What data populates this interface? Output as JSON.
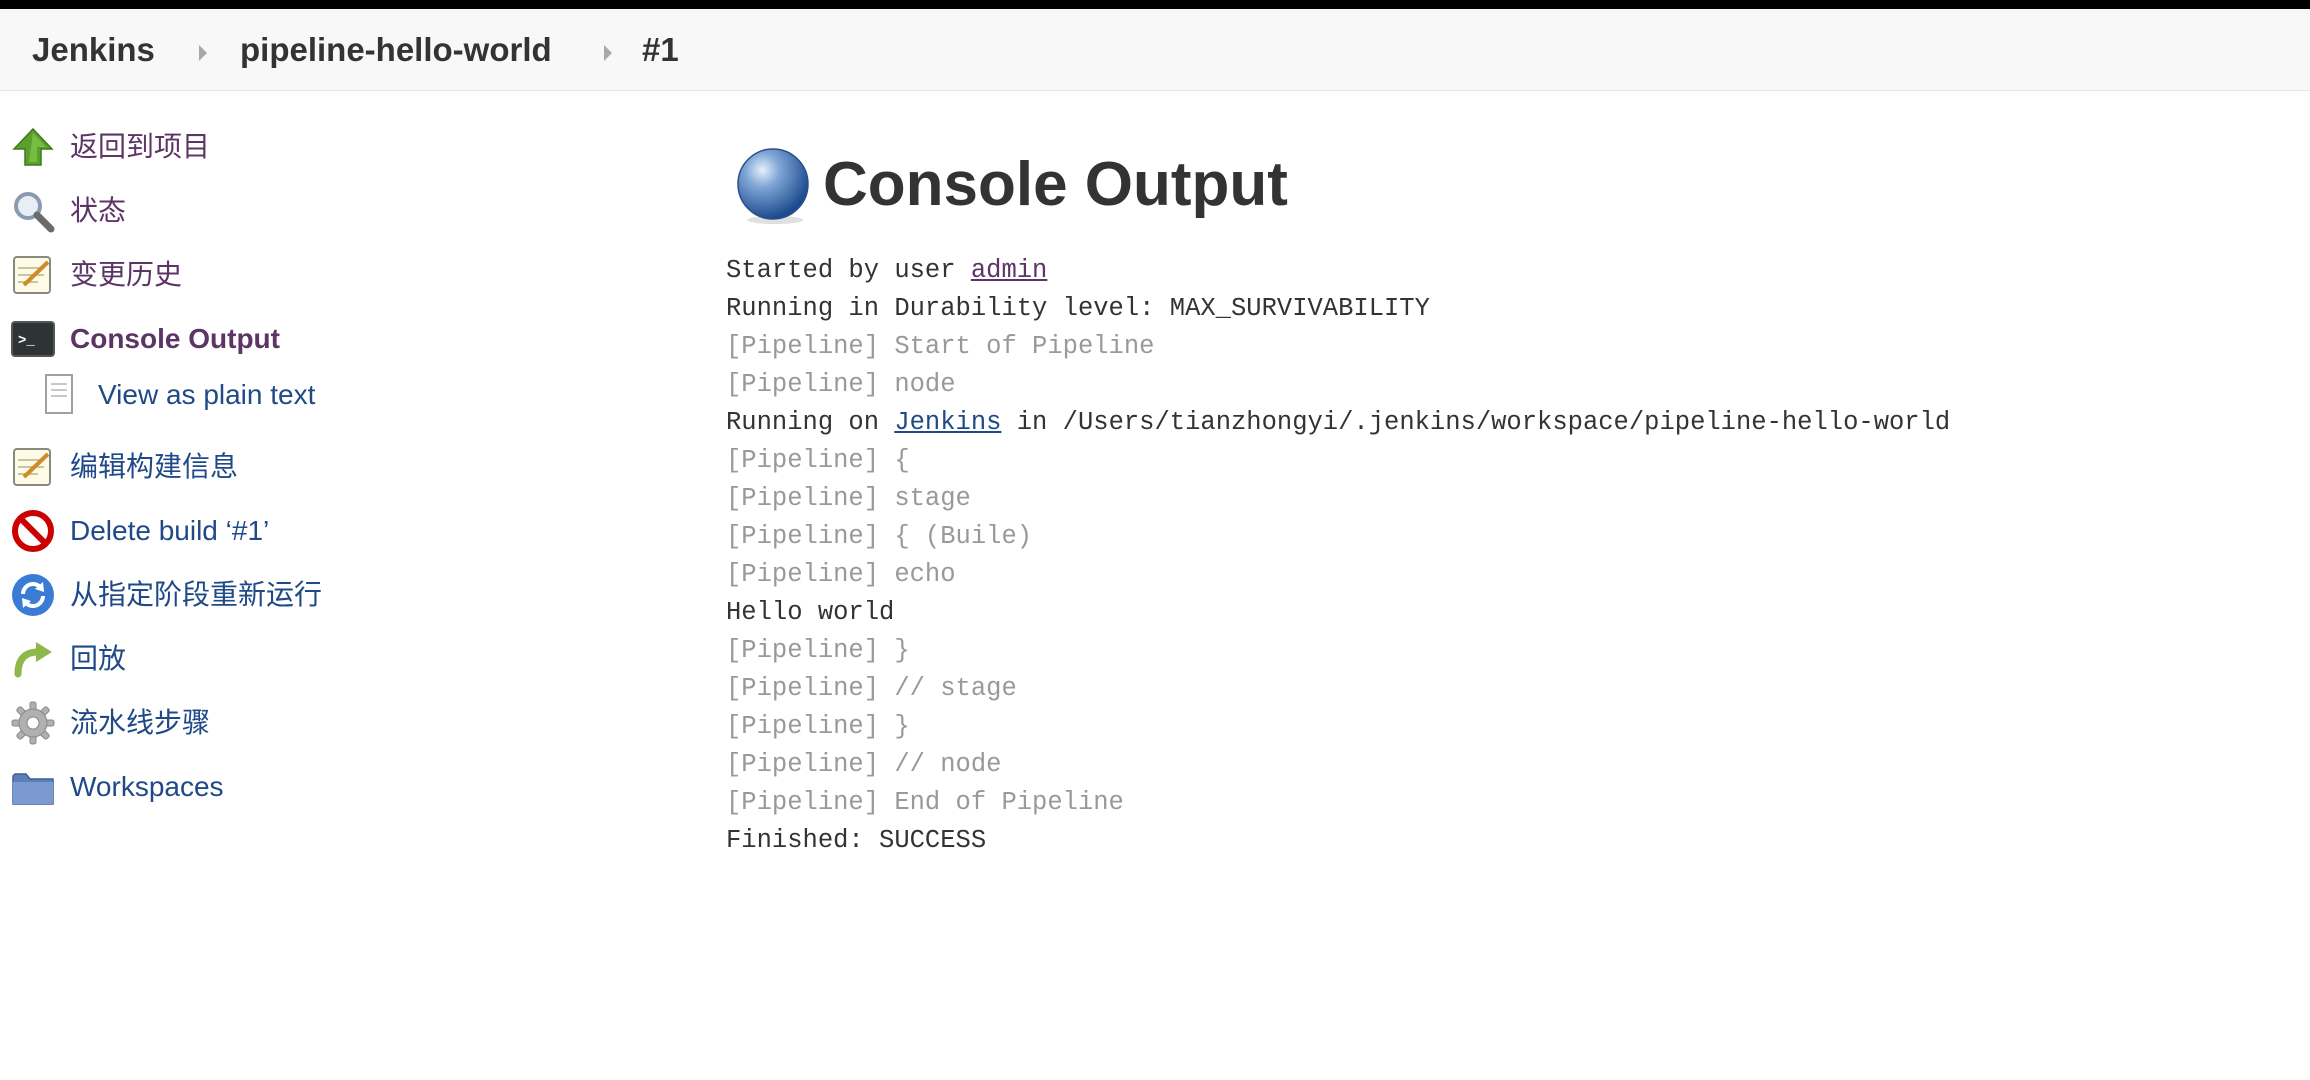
{
  "breadcrumbs": [
    {
      "label": "Jenkins"
    },
    {
      "label": "pipeline-hello-world"
    },
    {
      "label": "#1"
    }
  ],
  "sidebar": {
    "items": [
      {
        "label": "返回到项目",
        "icon": "up-arrow-icon"
      },
      {
        "label": "状态",
        "icon": "search-icon"
      },
      {
        "label": "变更历史",
        "icon": "notepad-icon"
      },
      {
        "label": "Console Output",
        "icon": "terminal-icon",
        "active": true
      },
      {
        "label": "View as plain text",
        "icon": "document-icon"
      },
      {
        "label": "编辑构建信息",
        "icon": "notepad-icon"
      },
      {
        "label": "Delete build ‘#1’",
        "icon": "no-entry-icon"
      },
      {
        "label": "从指定阶段重新运行",
        "icon": "refresh-icon"
      },
      {
        "label": "回放",
        "icon": "redo-arrow-icon"
      },
      {
        "label": "流水线步骤",
        "icon": "gear-icon"
      },
      {
        "label": "Workspaces",
        "icon": "folder-icon"
      }
    ]
  },
  "main": {
    "title": "Console Output",
    "title_icon": "blue-ball-icon",
    "console": {
      "line1_prefix": "Started by user ",
      "line1_link": "admin",
      "line2": "Running in Durability level: MAX_SURVIVABILITY",
      "line3": "[Pipeline] Start of Pipeline",
      "line4": "[Pipeline] node",
      "line5_prefix": "Running on ",
      "line5_link": "Jenkins",
      "line5_suffix": " in /Users/tianzhongyi/.jenkins/workspace/pipeline-hello-world",
      "line6": "[Pipeline] {",
      "line7": "[Pipeline] stage",
      "line8": "[Pipeline] { (Buile)",
      "line9": "[Pipeline] echo",
      "line10": "Hello world",
      "line11": "[Pipeline] }",
      "line12": "[Pipeline] // stage",
      "line13": "[Pipeline] }",
      "line14": "[Pipeline] // node",
      "line15": "[Pipeline] End of Pipeline",
      "line16": "Finished: SUCCESS"
    }
  },
  "colors": {
    "link": "#204a87",
    "visited_link": "#5c3566",
    "pipeline_dim": "#999999",
    "text": "#333333"
  }
}
